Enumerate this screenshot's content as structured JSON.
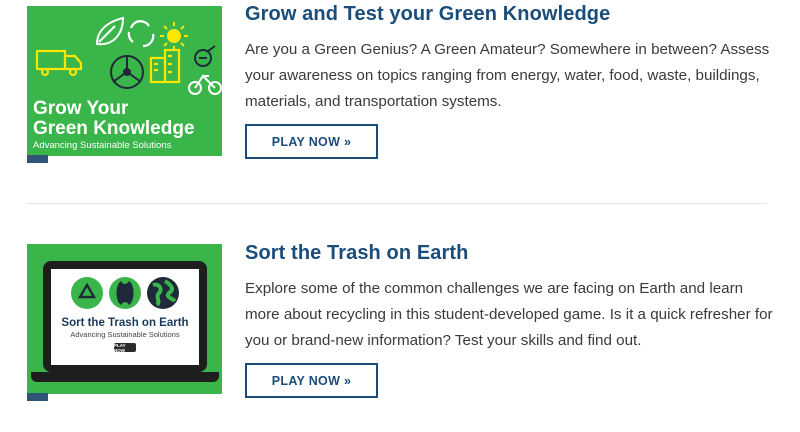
{
  "games": [
    {
      "title": "Grow and Test your Green Knowledge",
      "description": "Are you a Green Genius? A Green Amateur? Somewhere in between? Assess your awareness on topics ranging from energy, water, food, waste, buildings, materials, and transportation systems.",
      "button_label": "PLAY NOW »",
      "image": {
        "line1": "Grow Your",
        "line2": "Green Knowledge",
        "line3": "Advancing Sustainable Solutions",
        "bg_color": "#3ab54a"
      }
    },
    {
      "title": "Sort the Trash on Earth",
      "description": "Explore some of the common challenges we are facing on Earth and learn more about recycling in this student-developed game. Is it a quick refresher for you or brand-new information? Test your skills and find out.",
      "button_label": "PLAY NOW »",
      "image": {
        "title": "Sort the Trash on Earth",
        "subtitle": "Advancing Sustainable Solutions",
        "button_label": "PLAY NOW",
        "bg_color": "#3ab54a"
      }
    }
  ],
  "colors": {
    "title": "#1a4d7a",
    "text": "#3a3a3a",
    "accent_green": "#3ab54a",
    "tag": "#2f5477"
  }
}
